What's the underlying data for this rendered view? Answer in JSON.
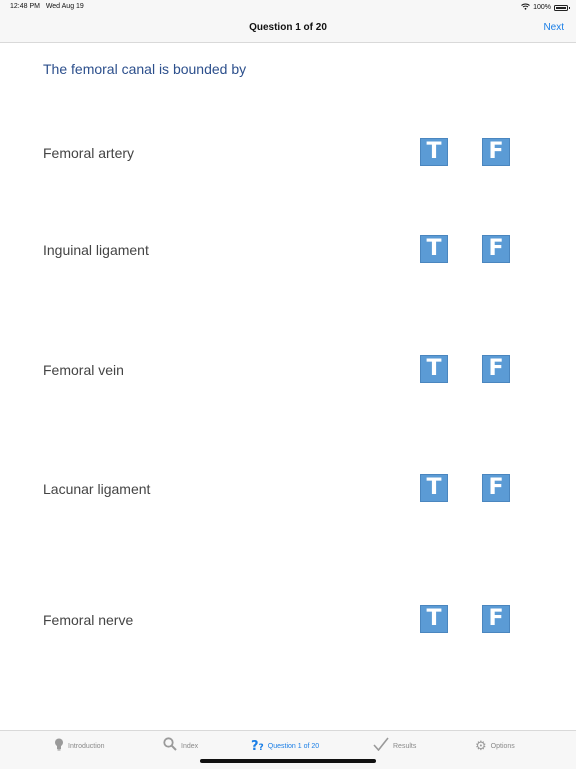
{
  "status": {
    "time": "12:48 PM",
    "date": "Wed Aug 19",
    "battery": "100%"
  },
  "nav": {
    "title": "Question 1 of 20",
    "next": "Next"
  },
  "question": "The femoral canal is bounded by",
  "answers": [
    {
      "label": "Femoral artery",
      "true_label": "T",
      "false_label": "F"
    },
    {
      "label": "Inguinal ligament",
      "true_label": "T",
      "false_label": "F"
    },
    {
      "label": "Femoral vein",
      "true_label": "T",
      "false_label": "F"
    },
    {
      "label": "Lacunar ligament",
      "true_label": "T",
      "false_label": "F"
    },
    {
      "label": "Femoral nerve",
      "true_label": "T",
      "false_label": "F"
    }
  ],
  "tabs": [
    {
      "label": "Introduction",
      "icon": "lightbulb-icon"
    },
    {
      "label": "Index",
      "icon": "search-icon"
    },
    {
      "label": "Question 1 of 20",
      "icon": "question-icon",
      "active": true
    },
    {
      "label": "Results",
      "icon": "checkmark-icon"
    },
    {
      "label": "Options",
      "icon": "gears-icon"
    }
  ]
}
